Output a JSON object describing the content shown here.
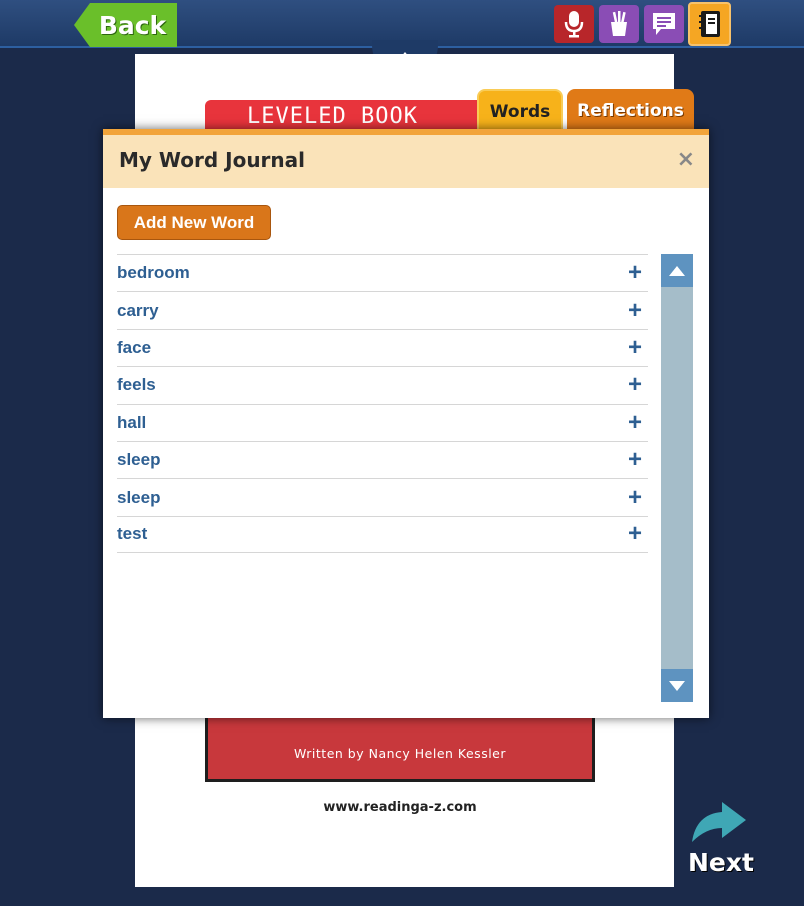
{
  "topbar": {
    "back_label": "Back",
    "tools": [
      {
        "name": "record",
        "icon": "microphone-icon"
      },
      {
        "name": "tools",
        "icon": "cup-icon"
      },
      {
        "name": "comment",
        "icon": "speech-bubble-icon"
      },
      {
        "name": "journal",
        "icon": "journal-icon"
      }
    ]
  },
  "book": {
    "banner": "LEVELED BOOK",
    "author": "Written by Nancy Helen Kessler",
    "website": "www.readinga-z.com"
  },
  "tabs": [
    {
      "label": "Words",
      "active": true
    },
    {
      "label": "Reflections",
      "active": false
    }
  ],
  "journal": {
    "title": "My Word Journal",
    "close_symbol": "×",
    "add_button": "Add New Word",
    "words": [
      "bedroom",
      "carry",
      "face",
      "feels",
      "hall",
      "sleep",
      "sleep",
      "test"
    ],
    "add_symbol": "+"
  },
  "nav": {
    "next_label": "Next"
  },
  "colors": {
    "background": "#1b2a4a",
    "back_green": "#6abf2a",
    "accent_orange": "#d9761a",
    "word_blue": "#2e5f92",
    "header_cream": "#fae3b9"
  }
}
